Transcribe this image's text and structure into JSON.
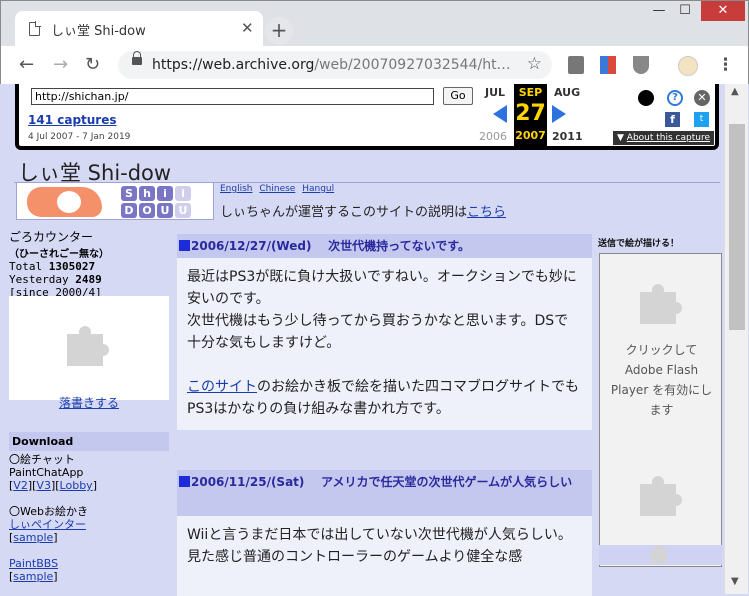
{
  "browser": {
    "tab_title": "しぃ堂 Shi-dow",
    "address_host": "https://web.archive.org",
    "address_path": "/web/20070927032544/ht…",
    "new_tab_label": "+",
    "close_tab_label": "✕",
    "win_min": "—",
    "win_max": "☐",
    "win_close": "✕"
  },
  "wayback": {
    "url_value": "http://shichan.jp/",
    "go_label": "Go",
    "captures_link": "141 captures",
    "date_range": "4 Jul 2007 - 7 Jan 2019",
    "prev_month": "JUL",
    "current_month": "SEP",
    "next_month": "AUG",
    "current_day": "27",
    "prev_year": "2006",
    "current_year": "2007",
    "next_year": "2011",
    "about_link": "About this capture",
    "help_glyph": "?",
    "close_glyph": "✕",
    "facebook_glyph": "f",
    "twitter_glyph": "t"
  },
  "site": {
    "title": "しぃ堂 Shi-dow",
    "langs": [
      "English",
      "Chinese",
      "Hangul"
    ],
    "intro_text": "しぃちゃんが運営するこのサイトの説明は",
    "intro_link": "こちら"
  },
  "counter": {
    "title": "ごろカウンター",
    "subtitle": "（ひーされごー無な）",
    "total_label": "Total",
    "total_value": "1305027",
    "yesterday_label": "Yesterday",
    "yesterday_value": "2489",
    "since": "[since 2000/4]"
  },
  "rakugaki_link": "落書きする",
  "download": {
    "heading": "Download",
    "paintchat_bullet": "〇絵チャット",
    "paintchat_name": "PaintChatApp",
    "link_v2": "V2",
    "link_v3": "V3",
    "link_lobby": "Lobby",
    "web_bullet": "〇Webお絵かき",
    "shi_painter": "しぃペインター",
    "sample1": "sample",
    "paintbbs": "PaintBBS",
    "sample2": "sample"
  },
  "posts": [
    {
      "date": "2006/12/27/(Wed)",
      "title": "次世代機持ってないです。",
      "para1": "最近はPS3が既に負け大扱いですねい。オークションでも妙に安いのです。",
      "para2": "次世代機はもう少し待ってから買おうかなと思います。DSで十分な気もしますけど。",
      "link": "このサイト",
      "para3": "のお絵かき板で絵を描いた四コマブログサイトでもPS3はかなりの負け組みな書かれ方です。"
    },
    {
      "date": "2006/11/25/(Sat)",
      "title": "アメリカで任天堂の次世代ゲームが人気らしい",
      "para1": "Wiiと言うまだ日本では出していない次世代機が人気らしい。",
      "para2": "見た感じ普通のコントローラーのゲームより健全な感"
    }
  ],
  "right": {
    "heading": "送信で絵が描ける！",
    "flash_text": "クリックして Adobe Flash Player を有効にします"
  }
}
